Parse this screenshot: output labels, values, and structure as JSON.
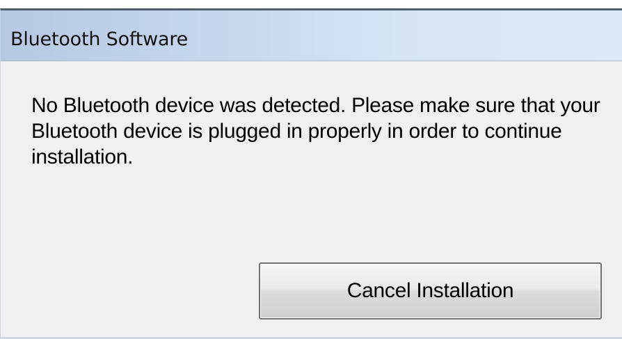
{
  "dialog": {
    "title": "Bluetooth Software",
    "message": "No Bluetooth device was detected. Please make sure that your Bluetooth device is plugged in properly in order to continue installation.",
    "cancel_label": "Cancel Installation"
  }
}
